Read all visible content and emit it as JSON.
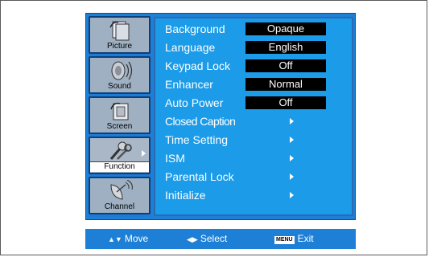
{
  "sidebar": {
    "items": [
      {
        "label": "Picture",
        "icon": "picture-icon"
      },
      {
        "label": "Sound",
        "icon": "sound-icon"
      },
      {
        "label": "Screen",
        "icon": "screen-icon"
      },
      {
        "label": "Function",
        "icon": "function-icon",
        "selected": true
      },
      {
        "label": "Channel",
        "icon": "channel-icon"
      }
    ]
  },
  "menu": {
    "rows": [
      {
        "label": "Background",
        "value": "Opaque"
      },
      {
        "label": "Language",
        "value": "English"
      },
      {
        "label": "Keypad Lock",
        "value": "Off"
      },
      {
        "label": "Enhancer",
        "value": "Normal"
      },
      {
        "label": "Auto Power",
        "value": "Off"
      },
      {
        "label": "Closed Caption",
        "submenu": true
      },
      {
        "label": "Time Setting",
        "submenu": true
      },
      {
        "label": "ISM",
        "submenu": true
      },
      {
        "label": "Parental Lock",
        "submenu": true
      },
      {
        "label": "Initialize",
        "submenu": true
      }
    ]
  },
  "footer": {
    "move_label": "Move",
    "select_label": "Select",
    "menu_key": "MENU",
    "exit_label": "Exit"
  },
  "colors": {
    "panel_blue": "#1e7fd6",
    "content_blue": "#1b9be8",
    "sidebar_tile": "#9fb0c2",
    "value_box": "#000000"
  }
}
